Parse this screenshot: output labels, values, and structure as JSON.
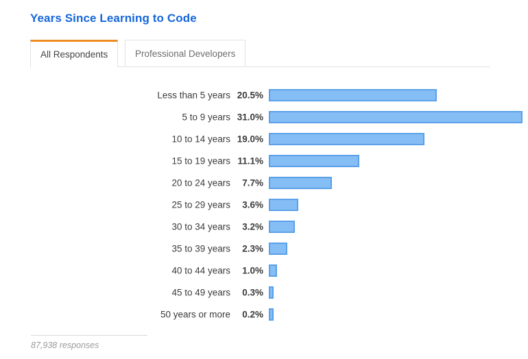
{
  "header": {
    "title": "Years Since Learning to Code",
    "accent_color": "#ef8a22",
    "title_color": "#1566d8"
  },
  "tabs": [
    {
      "label": "All Respondents",
      "active": true
    },
    {
      "label": "Professional Developers",
      "active": false
    }
  ],
  "footer": {
    "responses": "87,938 responses"
  },
  "chart_data": {
    "type": "bar",
    "orientation": "horizontal",
    "title": "Years Since Learning to Code",
    "xlabel": "",
    "ylabel": "",
    "xlim": [
      0,
      31.0
    ],
    "grid": false,
    "legend": false,
    "bar_fill_color": "#85bdf5",
    "bar_border_color": "#5ba0e8",
    "value_suffix": "%",
    "categories": [
      "Less than 5 years",
      "5 to 9 years",
      "10 to 14 years",
      "15 to 19 years",
      "20 to 24 years",
      "25 to 29 years",
      "30 to 34 years",
      "35 to 39 years",
      "40 to 44 years",
      "45 to 49 years",
      "50 years or more"
    ],
    "values": [
      20.5,
      31.0,
      19.0,
      11.1,
      7.7,
      3.6,
      3.2,
      2.3,
      1.0,
      0.3,
      0.2
    ],
    "value_labels": [
      "20.5%",
      "31.0%",
      "19.0%",
      "11.1%",
      "7.7%",
      "3.6%",
      "3.2%",
      "2.3%",
      "1.0%",
      "0.3%",
      "0.2%"
    ]
  }
}
